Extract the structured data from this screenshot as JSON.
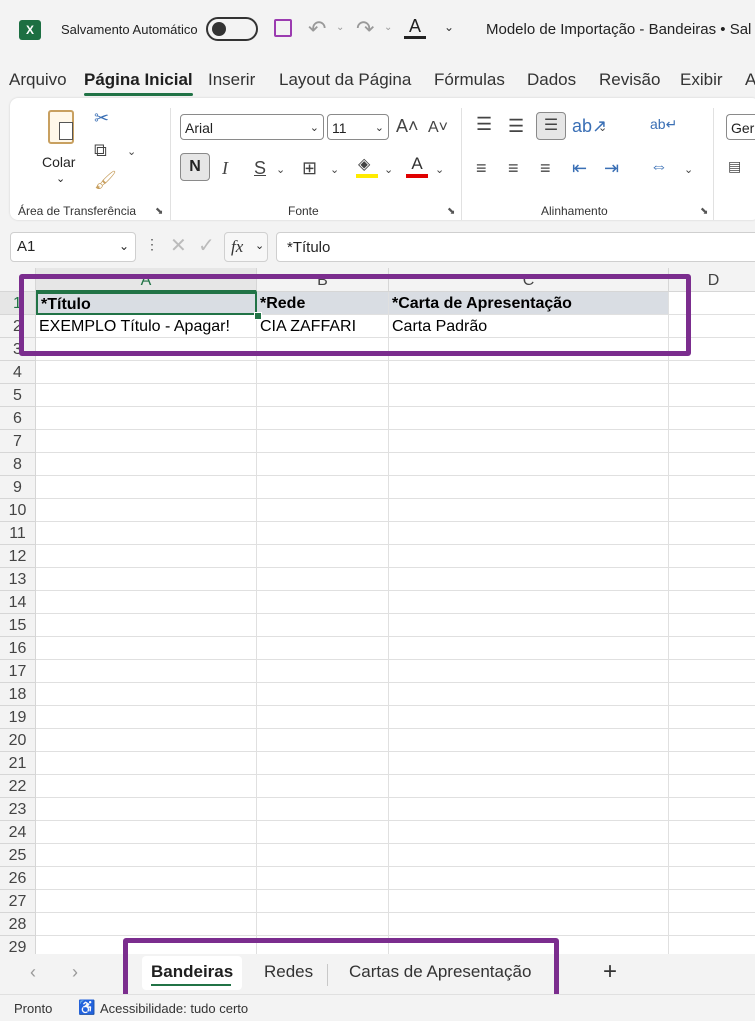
{
  "titlebar": {
    "autosave_label": "Salvamento Automático",
    "title": "Modelo de Importação - Bandeiras • Sal"
  },
  "ribbon_tabs": [
    "Arquivo",
    "Página Inicial",
    "Inserir",
    "Layout da Página",
    "Fórmulas",
    "Dados",
    "Revisão",
    "Exibir",
    "A"
  ],
  "ribbon": {
    "paste_label": "Colar",
    "clipboard_group": "Área de Transferência",
    "font_group": "Fonte",
    "alignment_group": "Alinhamento",
    "font_name": "Arial",
    "font_size": "11",
    "bold": "N",
    "italic": "I",
    "underline": "S",
    "number_format": "Gera"
  },
  "formula_bar": {
    "name_box": "A1",
    "fx": "fx",
    "content": "*Título"
  },
  "columns": [
    "A",
    "B",
    "C",
    "D"
  ],
  "rows": [
    "1",
    "2",
    "3",
    "4",
    "5",
    "6",
    "7",
    "8",
    "9",
    "10",
    "11",
    "12",
    "13",
    "14",
    "15",
    "16",
    "17",
    "18",
    "19",
    "20",
    "21",
    "22",
    "23",
    "24",
    "25",
    "26",
    "27",
    "28",
    "29"
  ],
  "cells": {
    "header": [
      "*Título",
      "*Rede",
      "*Carta de Apresentação"
    ],
    "row2": [
      "EXEMPLO Título - Apagar!",
      "CIA ZAFFARI",
      "Carta Padrão"
    ]
  },
  "sheets": [
    "Bandeiras",
    "Redes",
    "Cartas de Apresentação"
  ],
  "add_sheet": "+",
  "status": {
    "ready": "Pronto",
    "accessibility": "Acessibilidade: tudo certo"
  },
  "colors": {
    "excel_green": "#217346",
    "highlight_purple": "#7b2d8e",
    "header_fill": "#d9dde3"
  }
}
